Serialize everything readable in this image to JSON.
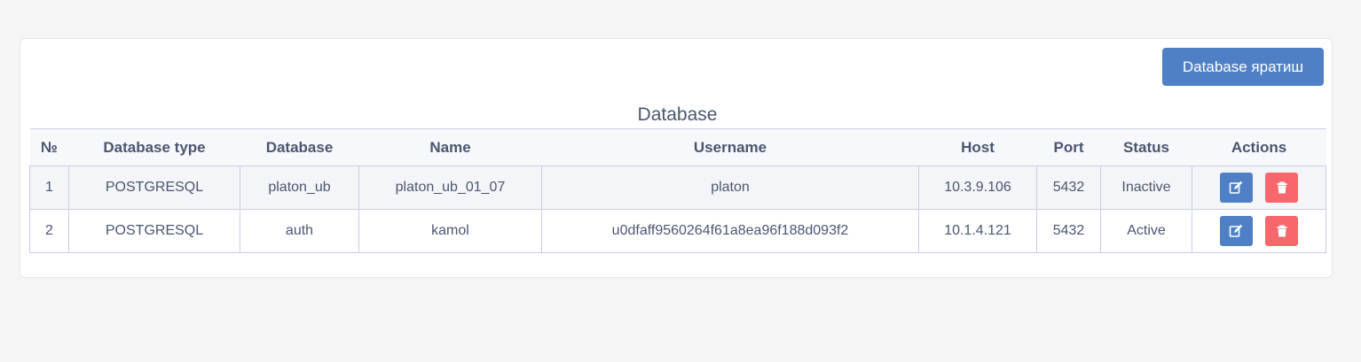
{
  "toolbar": {
    "create_label": "Database яратиш"
  },
  "table": {
    "title": "Database",
    "headers": [
      "№",
      "Database type",
      "Database",
      "Name",
      "Username",
      "Host",
      "Port",
      "Status",
      "Actions"
    ],
    "rows": [
      {
        "no": "1",
        "type": "POSTGRESQL",
        "database": "platon_ub",
        "name": "platon_ub_01_07",
        "username": "platon",
        "host": "10.3.9.106",
        "port": "5432",
        "status": "Inactive"
      },
      {
        "no": "2",
        "type": "POSTGRESQL",
        "database": "auth",
        "name": "kamol",
        "username": "u0dfaff9560264f61a8ea96f188d093f2",
        "host": "10.1.4.121",
        "port": "5432",
        "status": "Active"
      }
    ]
  },
  "icons": {
    "edit": "edit-icon",
    "delete": "trash-icon"
  },
  "colors": {
    "primary": "#4f80c6",
    "danger": "#f7676b",
    "text": "#4a5670"
  }
}
